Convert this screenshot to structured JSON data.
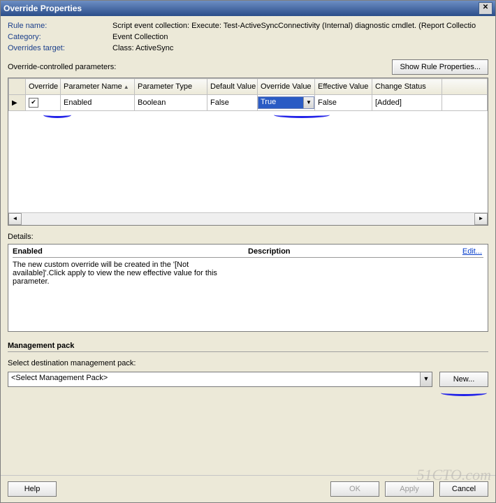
{
  "title": "Override Properties",
  "close_glyph": "✕",
  "props": {
    "rule_name_label": "Rule name:",
    "rule_name_value": "Script event collection: Execute: Test-ActiveSyncConnectivity (Internal) diagnostic cmdlet. (Report Collectio",
    "category_label": "Category:",
    "category_value": "Event Collection",
    "target_label": "Overrides target:",
    "target_value": "Class: ActiveSync"
  },
  "params_label": "Override-controlled parameters:",
  "show_rule_btn": "Show Rule Properties...",
  "grid": {
    "headers": {
      "override": "Override",
      "param_name": "Parameter Name",
      "param_type": "Parameter Type",
      "default_value": "Default Value",
      "override_value": "Override Value",
      "effective_value": "Effective Value",
      "change_status": "Change Status"
    },
    "row": {
      "checked": "✔",
      "param_name": "Enabled",
      "param_type": "Boolean",
      "default_value": "False",
      "override_value": "True",
      "effective_value": "False",
      "change_status": "[Added]"
    }
  },
  "details": {
    "section_label": "Details:",
    "title": "Enabled",
    "desc_label": "Description",
    "edit_link": "Edit...",
    "body": "The new custom override will be created in the '[Not available]'.Click apply to view the new effective value for this parameter."
  },
  "mp": {
    "heading": "Management pack",
    "prompt": "Select destination management pack:",
    "selected": "<Select Management Pack>",
    "new_btn": "New..."
  },
  "footer": {
    "help": "Help",
    "ok": "OK",
    "apply": "Apply",
    "cancel": "Cancel"
  },
  "watermark": "51CTO.com"
}
